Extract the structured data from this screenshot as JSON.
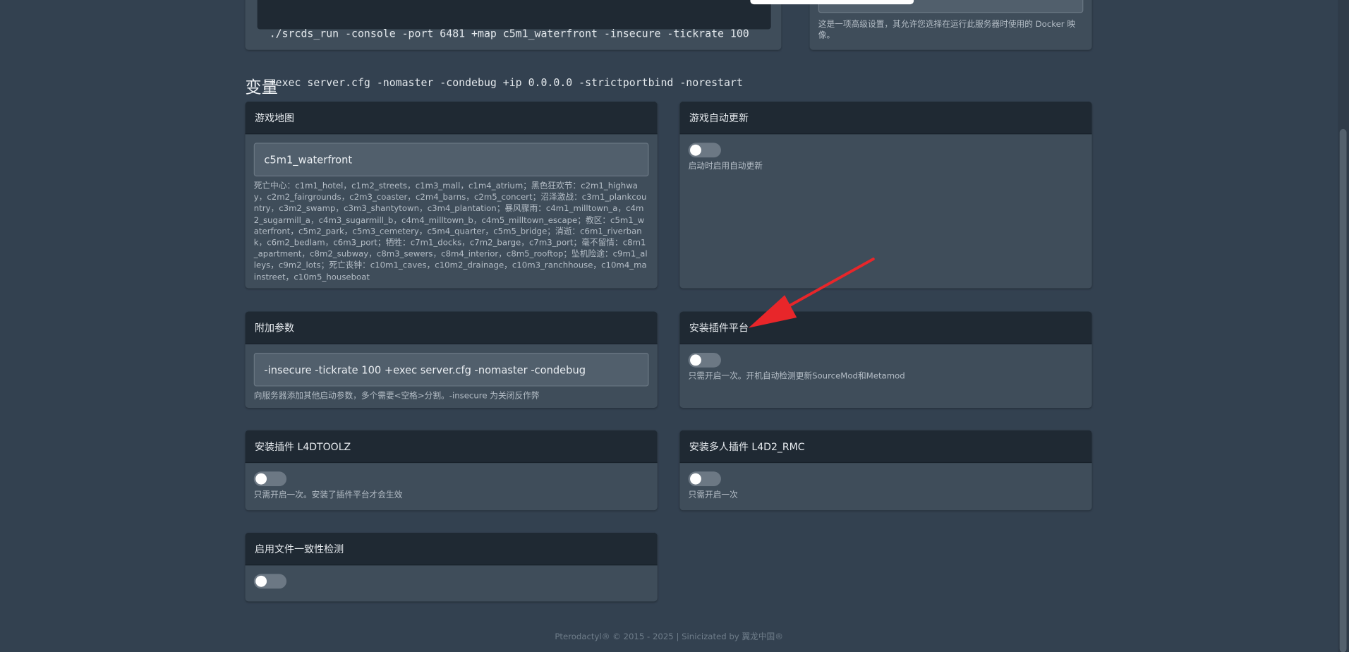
{
  "startup": {
    "command_line1": "./srcds_run -console -port 6481 +map c5m1_waterfront -insecure -tickrate 100",
    "command_line2": "+exec server.cfg -nomaster -condebug +ip 0.0.0.0 -strictportbind -norestart",
    "docker_help": "这是一项高级设置，其允许您选择在运行此服务器时使用的 Docker 映像。"
  },
  "variables_title": "变量",
  "game_map": {
    "title": "游戏地图",
    "value": "c5m1_waterfront",
    "help": "死亡中心：c1m1_hotel，c1m2_streets，c1m3_mall，c1m4_atrium；黑色狂欢节：c2m1_highway，c2m2_fairgrounds，c2m3_coaster，c2m4_barns，c2m5_concert；沼泽激战：c3m1_plankcountry，c3m2_swamp，c3m3_shantytown，c3m4_plantation；暴风骤雨：c4m1_milltown_a，c4m2_sugarmill_a，c4m3_sugarmill_b，c4m4_milltown_b，c4m5_milltown_escape；教区：c5m1_waterfront，c5m2_park，c5m3_cemetery，c5m4_quarter，c5m5_bridge；消逝：c6m1_riverbank，c6m2_bedlam，c6m3_port；牺牲：c7m1_docks，c7m2_barge，c7m3_port；毫不留情：c8m1_apartment，c8m2_subway，c8m3_sewers，c8m4_interior，c8m5_rooftop；坠机险途：c9m1_alleys，c9m2_lots；死亡丧钟：c10m1_caves，c10m2_drainage，c10m3_ranchhouse，c10m4_mainstreet，c10m5_houseboat"
  },
  "auto_update": {
    "title": "游戏自动更新",
    "enabled": false,
    "help": "启动时启用自动更新"
  },
  "extra_args": {
    "title": "附加参数",
    "value": "-insecure -tickrate 100 +exec server.cfg -nomaster -condebug",
    "help": "向服务器添加其他启动参数，多个需要<空格>分割。-insecure 为关闭反作弊"
  },
  "plugin_platform": {
    "title": "安装插件平台",
    "enabled": false,
    "help": "只需开启一次。开机自动检测更新SourceMod和Metamod"
  },
  "l4dtoolz": {
    "title": "安装插件 L4DTOOLZ",
    "enabled": false,
    "help": "只需开启一次。安装了插件平台才会生效"
  },
  "rmc": {
    "title": "安装多人插件 L4D2_RMC",
    "enabled": false,
    "help": "只需开启一次"
  },
  "consistency": {
    "title": "启用文件一致性检测",
    "enabled": false
  },
  "footer": "Pterodactyl® © 2015 - 2025 | Sinicizated by 翼龙中国®",
  "colors": {
    "background": "#334150",
    "panel": "#3f4d5a",
    "panel_header": "#1f2933",
    "arrow": "#e8262a"
  }
}
